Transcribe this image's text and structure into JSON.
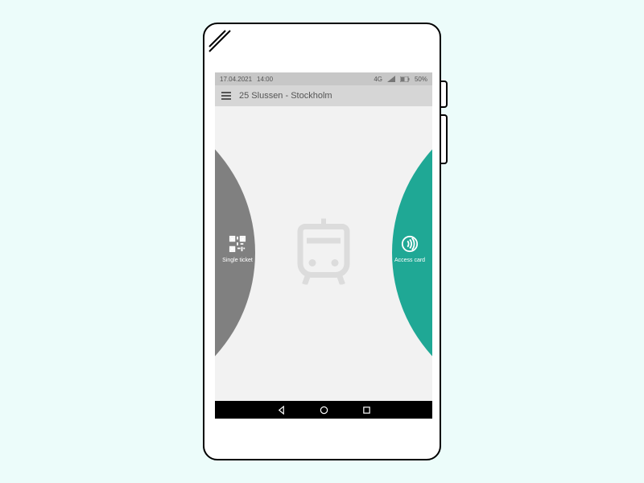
{
  "status": {
    "date": "17.04.2021",
    "time": "14:00",
    "network": "4G",
    "battery": "50%"
  },
  "app_bar": {
    "title": "25 Slussen - Stockholm"
  },
  "options": {
    "left_label": "Single ticket",
    "right_label": "Access card"
  },
  "colors": {
    "accent_left": "#808080",
    "accent_right": "#1fa895"
  }
}
